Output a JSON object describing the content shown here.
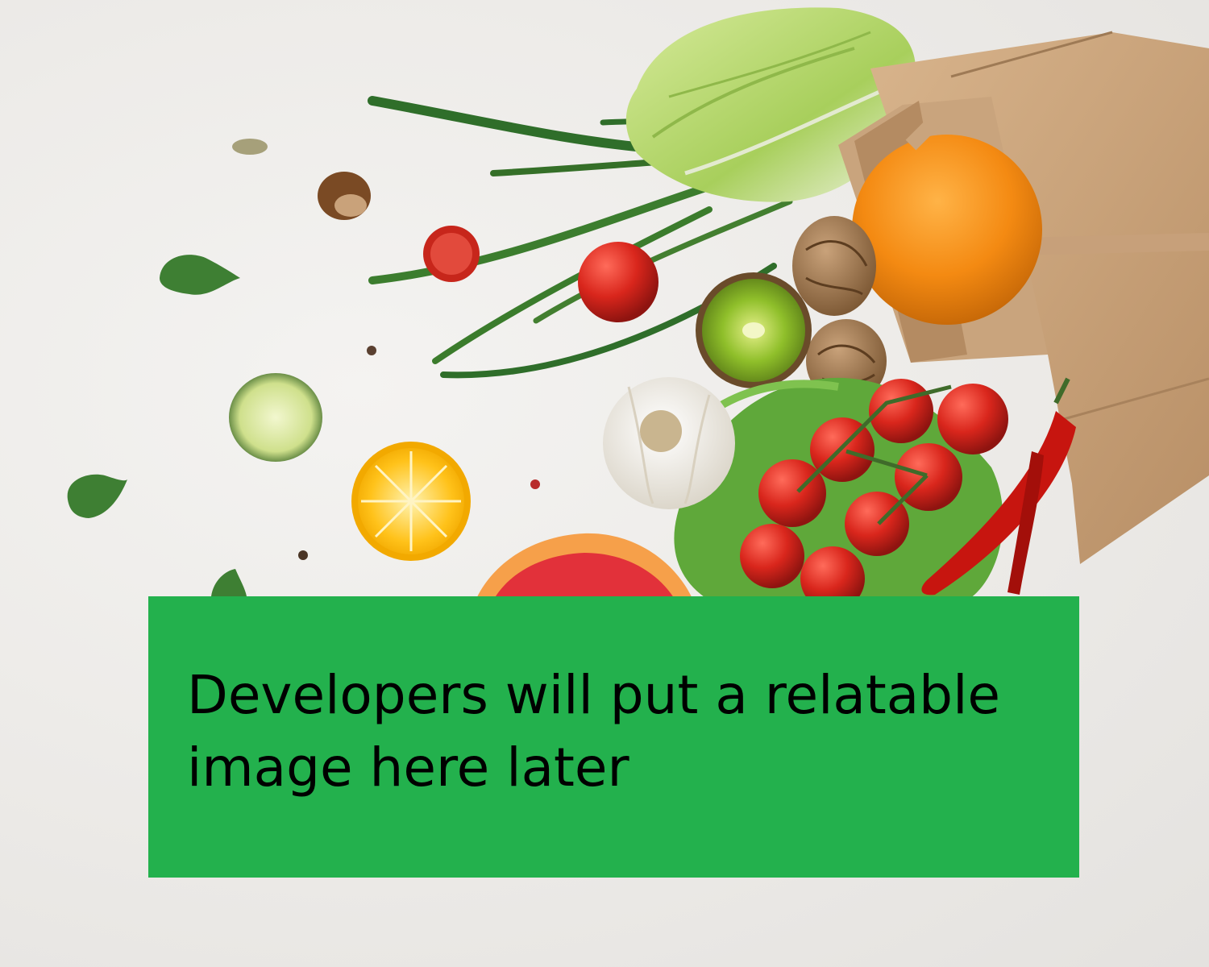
{
  "placeholder": {
    "text": "Developers will put a relatable image here later",
    "background": "#23b14d",
    "text_color": "#000000"
  },
  "photo": {
    "subject_icons": [
      "paper-bag-icon",
      "napa-cabbage-icon",
      "green-onion-icon",
      "orange-icon",
      "walnut-icon",
      "kiwi-icon",
      "garlic-icon",
      "cherry-tomato-icon",
      "lettuce-icon",
      "chili-pepper-icon",
      "cucumber-slice-icon",
      "lemon-half-icon",
      "grapefruit-icon",
      "hazelnut-icon",
      "spinach-leaf-icon",
      "peppercorn-icon"
    ]
  }
}
